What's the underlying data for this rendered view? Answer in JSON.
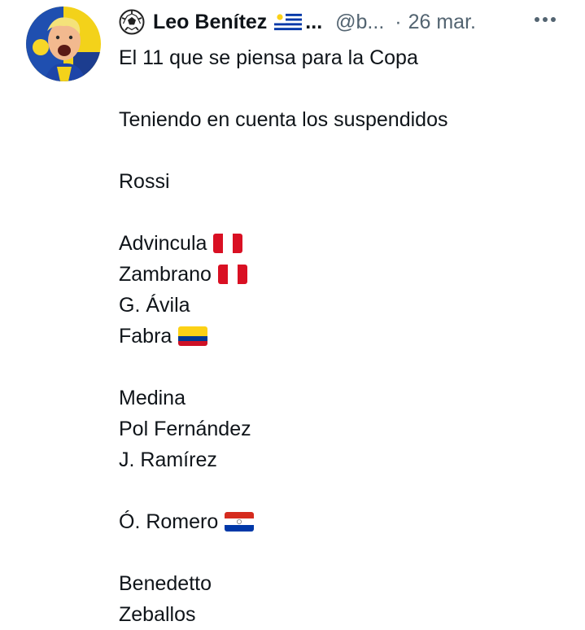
{
  "author": {
    "display_name": "Leo Benítez",
    "name_truncation": "...",
    "handle": "@b...",
    "separator": "·",
    "date": "26 mar.",
    "emoji_prefix": "soccer-ball-icon",
    "emoji_flag": "uruguay-flag-icon"
  },
  "tweet": {
    "lines": [
      {
        "text": "El 11 que se piensa para la Copa",
        "flag": null
      },
      {
        "text": "",
        "flag": null
      },
      {
        "text": "Teniendo en cuenta los suspendidos",
        "flag": null
      },
      {
        "text": "",
        "flag": null
      },
      {
        "text": "Rossi",
        "flag": null
      },
      {
        "text": "",
        "flag": null
      },
      {
        "text": "Advincula",
        "flag": "peru"
      },
      {
        "text": "Zambrano",
        "flag": "peru"
      },
      {
        "text": "G. Ávila",
        "flag": null
      },
      {
        "text": "Fabra",
        "flag": "colombia"
      },
      {
        "text": "",
        "flag": null
      },
      {
        "text": "Medina",
        "flag": null
      },
      {
        "text": "Pol Fernández",
        "flag": null
      },
      {
        "text": "J. Ramírez",
        "flag": null
      },
      {
        "text": "",
        "flag": null
      },
      {
        "text": "Ó. Romero",
        "flag": "paraguay"
      },
      {
        "text": "",
        "flag": null
      },
      {
        "text": "Benedetto",
        "flag": null
      },
      {
        "text": "Zeballos",
        "flag": null
      }
    ]
  },
  "colors": {
    "text_primary": "#0f1419",
    "text_secondary": "#536471",
    "peru_red": "#d91023",
    "colombia_yellow": "#fcd116",
    "colombia_blue": "#003893",
    "colombia_red": "#ce1126",
    "paraguay_red": "#d52b1e",
    "paraguay_blue": "#0038a8",
    "uruguay_blue": "#0038a8"
  }
}
